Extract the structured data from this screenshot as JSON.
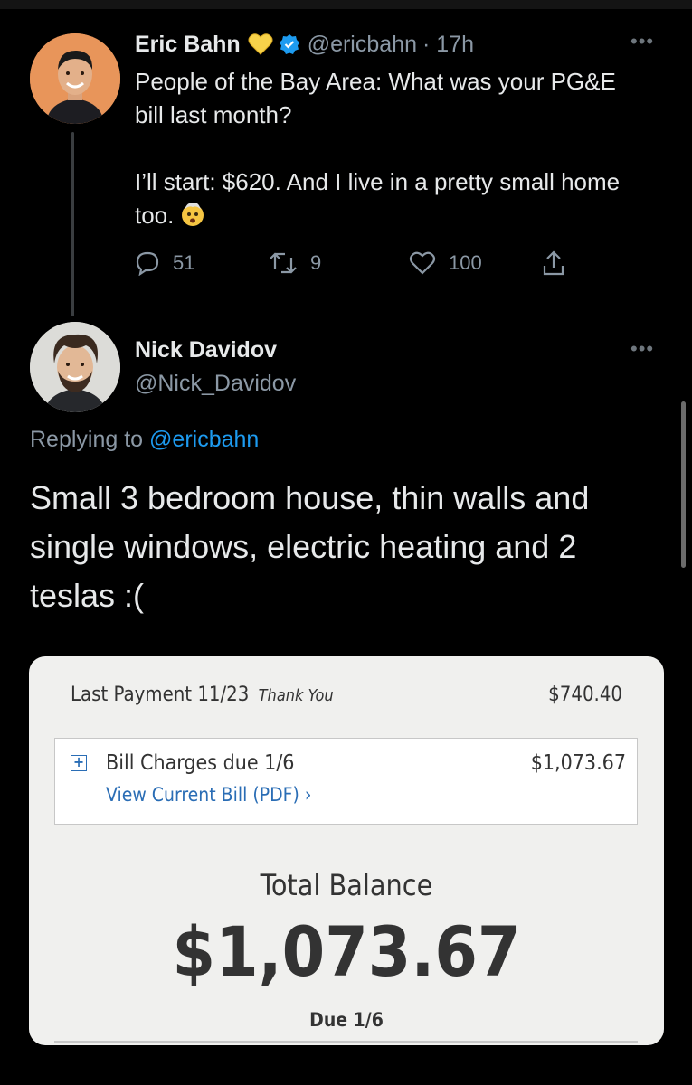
{
  "parent_tweet": {
    "name": "Eric Bahn",
    "handle": "@ericbahn",
    "time": "· 17h",
    "text_line1": "People of the Bay Area: What was your PG&E bill last month?",
    "text_line2": "I’ll start: $620. And I live in a pretty small home too.",
    "reply_count": "51",
    "retweet_count": "9",
    "like_count": "100",
    "more": "•••"
  },
  "reply_tweet": {
    "name": "Nick Davidov",
    "handle": "@Nick_Davidov",
    "replying_prefix": "Replying to",
    "replying_mention": "@ericbahn",
    "text": "Small 3 bedroom house, thin walls and single windows, electric heating and 2 teslas :(",
    "more": "•••"
  },
  "bill_image": {
    "last_payment_label": "Last Payment 11/23",
    "thank_you": "Thank You",
    "last_payment_amount": "$740.40",
    "charges_label": "Bill Charges due 1/6",
    "charges_link": "View Current Bill (PDF) ›",
    "charges_amount": "$1,073.67",
    "total_label": "Total Balance",
    "total_amount": "$1,073.67",
    "due": "Due 1/6"
  },
  "colors": {
    "background": "#000000",
    "link": "#1d9bf0",
    "secondary_text": "#8b98a5",
    "bill_link": "#2a6db5"
  },
  "icons": [
    "heart-badge-icon",
    "verified-icon",
    "reply-icon",
    "retweet-icon",
    "like-icon",
    "share-icon",
    "shocked-emoji-icon",
    "plus-box-icon"
  ]
}
